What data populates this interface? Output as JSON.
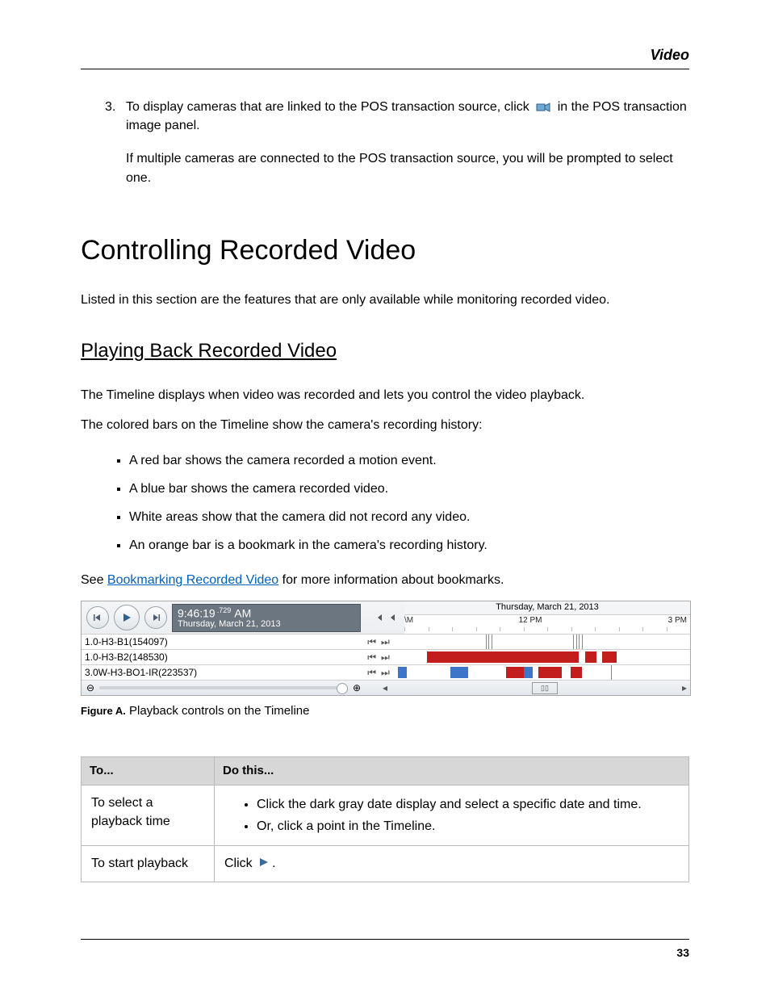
{
  "header": {
    "section_label": "Video",
    "page_number": "33"
  },
  "step3": {
    "number": "3.",
    "text_before_icon": "To display cameras that are linked to the POS transaction source, click",
    "text_after_icon": "in the POS transaction image panel.",
    "para2": "If multiple cameras are connected to the POS transaction source, you will be prompted to select one."
  },
  "h1": "Controlling Recorded Video",
  "intro": "Listed in this section are the features that are only available while monitoring recorded video.",
  "h2": "Playing Back Recorded Video",
  "para_timeline": "The Timeline displays when video was recorded and lets you control the video playback.",
  "para_colored": "The colored bars on the Timeline show the camera's recording history:",
  "bullets": {
    "b1": "A red bar shows the camera recorded a motion event.",
    "b2": "A blue bar shows the camera recorded video.",
    "b3": "White areas show that the camera did not record any video.",
    "b4": "An orange bar is a bookmark in the camera's recording history."
  },
  "see_sentence": {
    "pre": "See ",
    "link": "Bookmarking Recorded Video",
    "post": " for more information about bookmarks."
  },
  "timeline": {
    "time_main": "9:46:19",
    "time_frac": ".729",
    "time_ampm": "AM",
    "date_line": "Thursday, March 21, 2013",
    "ruler_date": "Thursday, March 21, 2013",
    "tick_left": "\\M",
    "tick_mid": "12 PM",
    "tick_right": "3 PM",
    "cam1": "1.0-H3-B1(154097)",
    "cam2": "1.0-H3-B2(148530)",
    "cam3": "3.0W-H3-BO1-IR(223537)"
  },
  "fig_caption": {
    "label": "Figure A.",
    "text": " Playback controls on the Timeline"
  },
  "table": {
    "header_to": "To...",
    "header_do": "Do this...",
    "row1": {
      "to": "To select a playback time",
      "item1": "Click the dark gray date display and select a specific date and time.",
      "item2": "Or, click a point in the Timeline."
    },
    "row2": {
      "to": "To start playback",
      "do_pre": "Click ",
      "do_post": "."
    }
  }
}
